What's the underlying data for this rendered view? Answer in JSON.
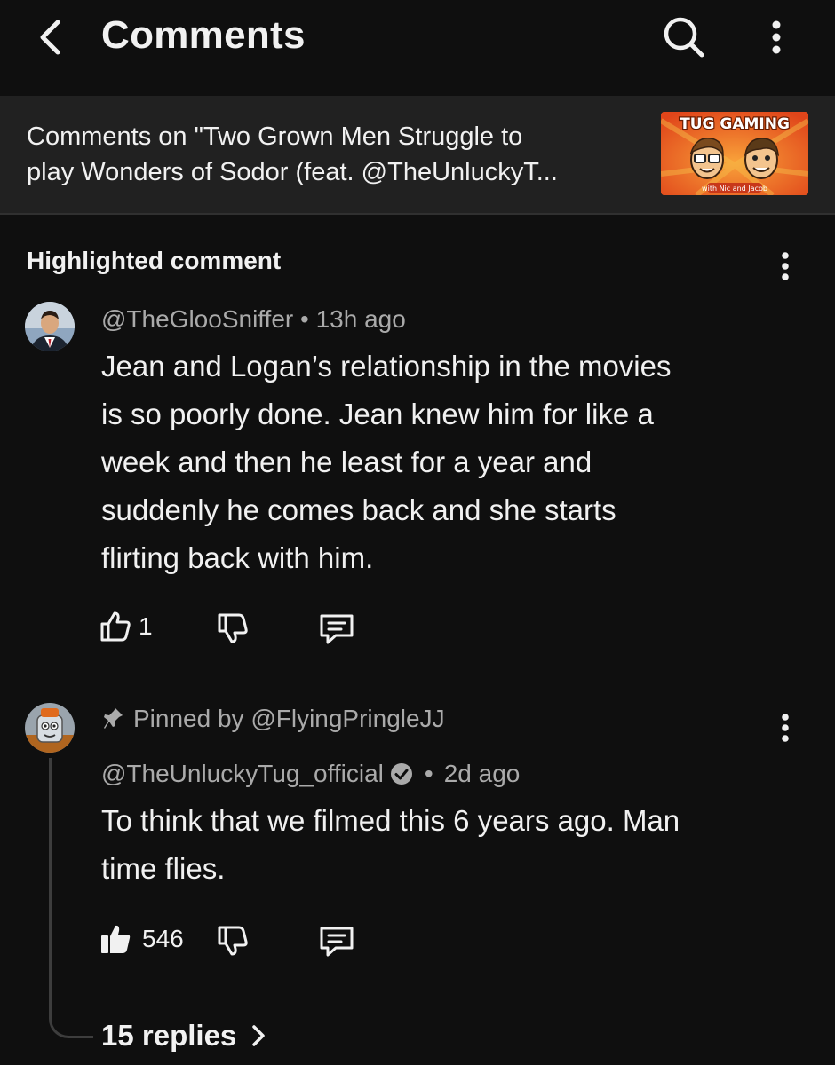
{
  "header": {
    "title": "Comments",
    "back_icon": "chevron-left-icon",
    "search_icon": "search-icon",
    "more_icon": "more-vertical-icon"
  },
  "video": {
    "line1": "Comments on \"Two Grown Men Struggle to",
    "line2": "play Wonders of Sodor (feat. @TheUnluckyT...",
    "thumb_title": "TUG GAMING",
    "thumb_subtitle": "with Nic and Jacob"
  },
  "highlighted": {
    "section_label": "Highlighted comment",
    "author": "@TheGlooSniffer",
    "time": "13h ago",
    "lines": [
      "Jean and Logan’s relationship in the movies",
      "is so poorly done. Jean knew him for like a",
      "week and then he least for a year and",
      "suddenly he comes back and she starts",
      "flirting back with him."
    ],
    "likes": "1"
  },
  "pinned": {
    "pinned_label": "Pinned by @FlyingPringleJJ",
    "author": "@TheUnluckyTug_official",
    "time": "2d ago",
    "lines": [
      "To think that we filmed this 6 years ago. Man",
      "time flies."
    ],
    "likes": "546",
    "replies": "15 replies"
  },
  "colors": {
    "background": "#0f0f0f",
    "banner": "#212121",
    "text": "#f1f1f1",
    "meta": "#aaaaaa",
    "thumb_orange": "#e8581b"
  }
}
